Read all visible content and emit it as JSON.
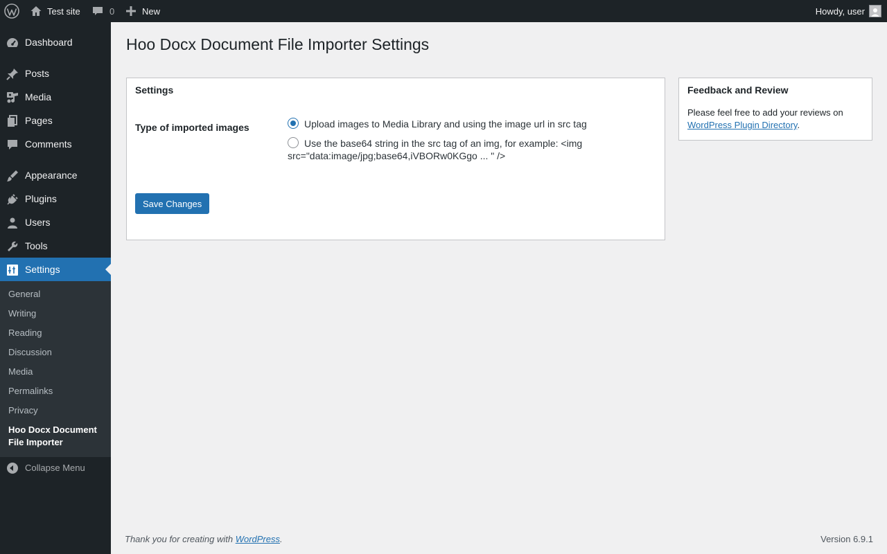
{
  "adminbar": {
    "site_name": "Test site",
    "comments_count": "0",
    "new_label": "New",
    "howdy": "Howdy, user"
  },
  "menu": {
    "items": [
      {
        "label": "Dashboard",
        "icon": "dashboard-icon"
      },
      {
        "label": "Posts",
        "icon": "pin-icon"
      },
      {
        "label": "Media",
        "icon": "media-icon"
      },
      {
        "label": "Pages",
        "icon": "pages-icon"
      },
      {
        "label": "Comments",
        "icon": "comment-icon"
      },
      {
        "label": "Appearance",
        "icon": "brush-icon"
      },
      {
        "label": "Plugins",
        "icon": "plugin-icon"
      },
      {
        "label": "Users",
        "icon": "user-icon"
      },
      {
        "label": "Tools",
        "icon": "wrench-icon"
      },
      {
        "label": "Settings",
        "icon": "settings-icon"
      }
    ],
    "submenu": [
      "General",
      "Writing",
      "Reading",
      "Discussion",
      "Media",
      "Permalinks",
      "Privacy",
      "Hoo Docx Document File Importer"
    ],
    "collapse_label": "Collapse Menu"
  },
  "page": {
    "title": "Hoo Docx Document File Importer Settings"
  },
  "settings_box": {
    "title": "Settings",
    "field_label": "Type of imported images",
    "option1": "Upload images to Media Library and using the image url in src tag",
    "option2": "Use the base64 string in the src tag of an img, for example: <img src=\"data:image/jpg;base64,iVBORw0KGgo ... \" />",
    "selected_option": 1,
    "save_label": "Save Changes"
  },
  "feedback_box": {
    "title": "Feedback and Review",
    "text": "Please feel free to add your reviews on ",
    "link": "WordPress Plugin Directory",
    "text_end": "."
  },
  "footer": {
    "thanks": "Thank you for creating with ",
    "wp_link": "WordPress",
    "thanks_end": ".",
    "version": "Version 6.9.1"
  },
  "colors": {
    "accent": "#2271b1",
    "menu_bg": "#1d2327",
    "submenu_bg": "#2c3338"
  }
}
